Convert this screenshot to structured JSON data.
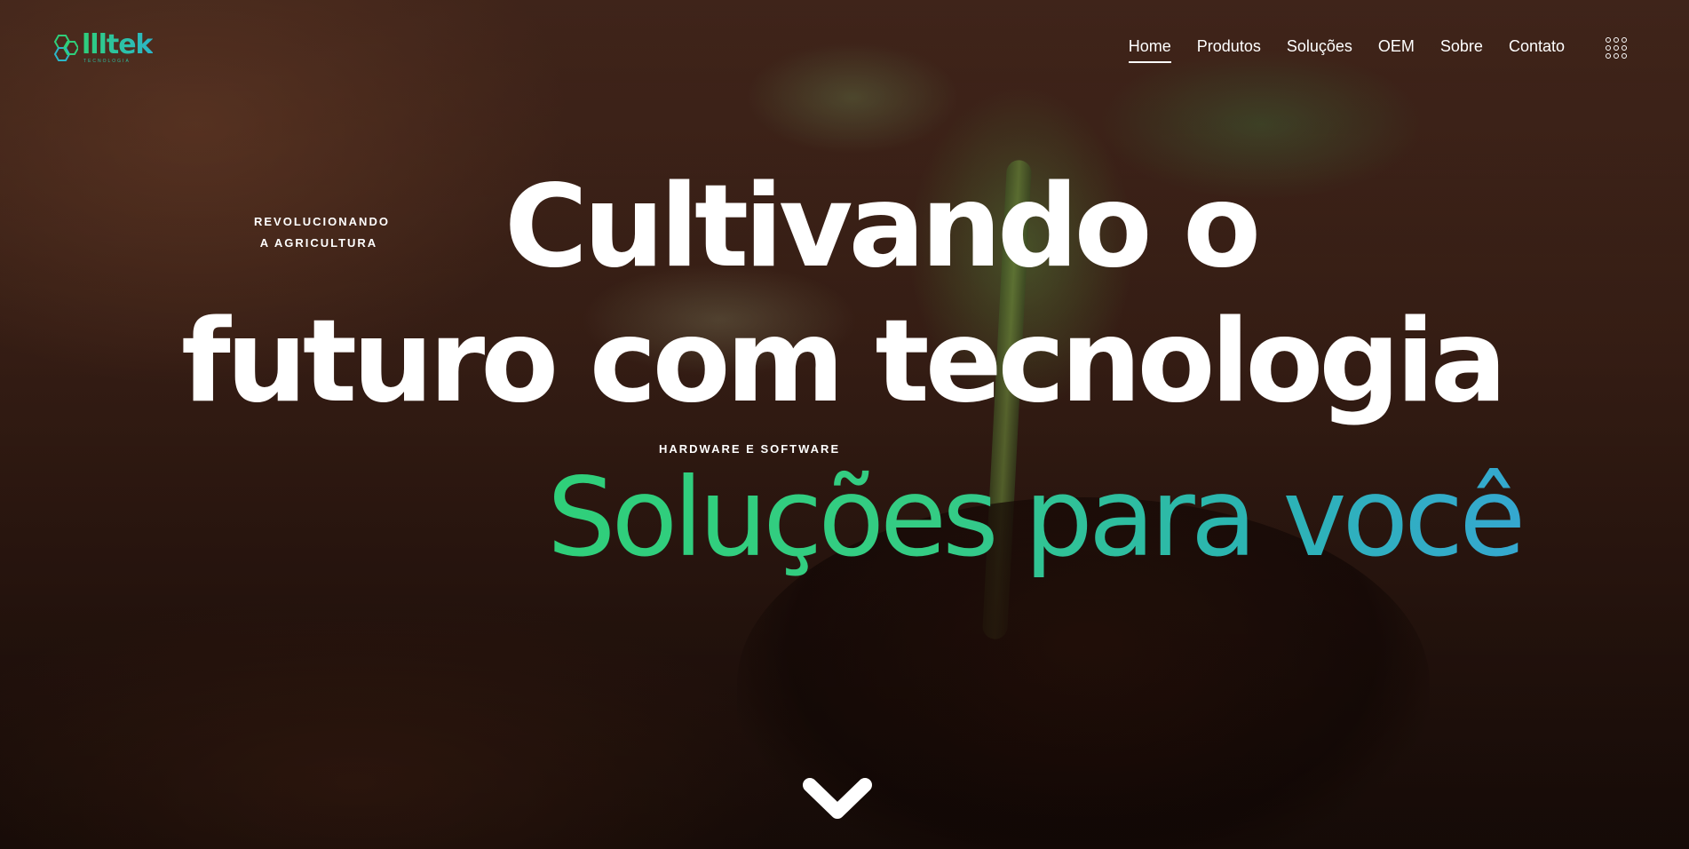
{
  "brand": {
    "name": "llltek",
    "sub": "TECNOLOGIA",
    "color_primary": "#2fcf7a",
    "color_secondary": "#2bb6c8"
  },
  "nav": {
    "items": [
      {
        "label": "Home",
        "active": true
      },
      {
        "label": "Produtos"
      },
      {
        "label": "Soluções"
      },
      {
        "label": "OEM"
      },
      {
        "label": "Sobre"
      },
      {
        "label": "Contato"
      }
    ],
    "menu_icon": "grid-menu-icon"
  },
  "hero": {
    "tagline_line1": "REVOLUCIONANDO",
    "tagline_line2": "A AGRICULTURA",
    "headline_line1": "Cultivando o",
    "headline_line2": "futuro com tecnologia",
    "small_label": "HARDWARE E SOFTWARE",
    "gradient_line": "Soluções para você",
    "gradient_colors": [
      "#2fcf7a",
      "#35a8d0"
    ],
    "scroll_icon": "chevron-down-icon"
  }
}
